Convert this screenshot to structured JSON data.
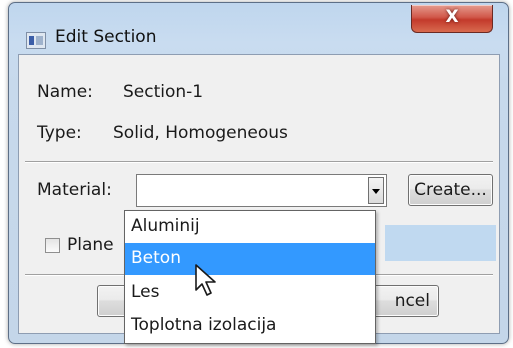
{
  "window": {
    "title": "Edit Section",
    "close_label": "X"
  },
  "section": {
    "name_label": "Name:",
    "name_value": "Section-1",
    "type_label": "Type:",
    "type_value": "Solid, Homogeneous"
  },
  "material": {
    "label": "Material:",
    "selected_value": "",
    "create_label": "Create...",
    "options": [
      "Aluminij",
      "Beton",
      "Les",
      "Toplotna izolacija"
    ],
    "highlighted_index": 1
  },
  "plane": {
    "label": "Plane",
    "checked": false
  },
  "buttons": {
    "cancel_label": "ncel"
  },
  "colors": {
    "highlight": "#3399ff",
    "close_button": "#c33a2b"
  }
}
